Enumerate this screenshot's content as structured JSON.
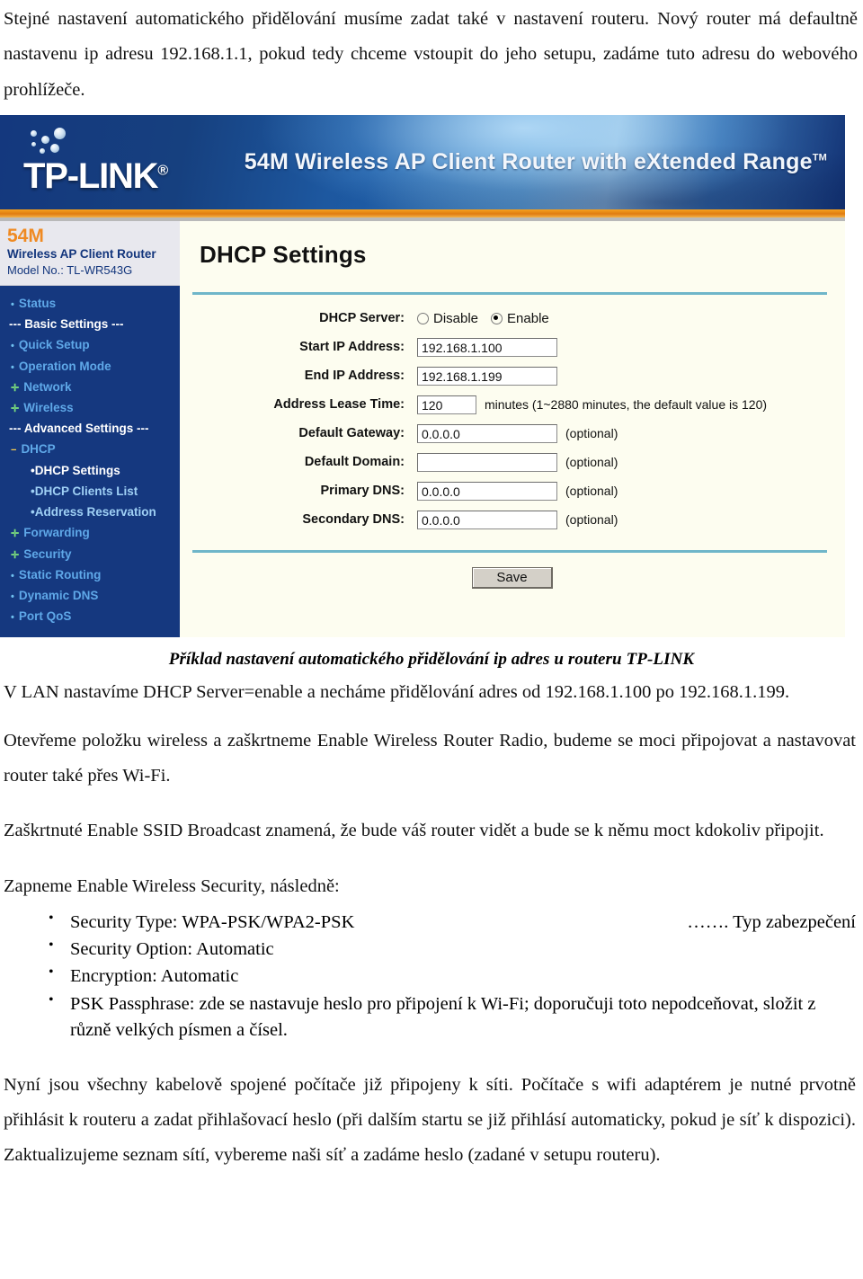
{
  "intro": {
    "paragraph": "Stejné nastavení automatického přidělování musíme zadat také v nastavení routeru. Nový router má defaultně nastavenu ip adresu 192.168.1.1, pokud tedy chceme vstoupit do jeho setupu, zadáme tuto adresu do webového prohlížeče."
  },
  "router_ui": {
    "brand": "TP-LINK",
    "brand_mark": "®",
    "tagline": "54M Wireless AP Client Router with eXtended Range",
    "tagline_mark": "TM",
    "sidebar": {
      "speed": "54M",
      "model_name": "Wireless AP Client Router",
      "model_no": "Model No.: TL-WR543G",
      "items": [
        {
          "label": "Status",
          "type": "link",
          "bullet": "dot"
        },
        {
          "label": "--- Basic Settings ---",
          "type": "section"
        },
        {
          "label": "Quick Setup",
          "type": "link",
          "bullet": "dot"
        },
        {
          "label": "Operation Mode",
          "type": "link",
          "bullet": "dot"
        },
        {
          "label": "Network",
          "type": "link",
          "bullet": "plus"
        },
        {
          "label": "Wireless",
          "type": "link",
          "bullet": "plus"
        },
        {
          "label": "--- Advanced Settings ---",
          "type": "section"
        },
        {
          "label": "DHCP",
          "type": "link",
          "bullet": "minus"
        },
        {
          "label": "DHCP Settings",
          "type": "sub",
          "active": true
        },
        {
          "label": "DHCP Clients List",
          "type": "sub",
          "active": false
        },
        {
          "label": "Address Reservation",
          "type": "sub",
          "active": false
        },
        {
          "label": "Forwarding",
          "type": "link",
          "bullet": "plus"
        },
        {
          "label": "Security",
          "type": "link",
          "bullet": "plus"
        },
        {
          "label": "Static Routing",
          "type": "link",
          "bullet": "dot"
        },
        {
          "label": "Dynamic DNS",
          "type": "link",
          "bullet": "dot"
        },
        {
          "label": "Port QoS",
          "type": "link",
          "bullet": "dot"
        }
      ]
    },
    "page_title": "DHCP Settings",
    "fields": {
      "dhcp_server_label": "DHCP Server:",
      "dhcp_disable_label": "Disable",
      "dhcp_enable_label": "Enable",
      "dhcp_selected": "Enable",
      "start_ip_label": "Start IP Address:",
      "start_ip_value": "192.168.1.100",
      "end_ip_label": "End IP Address:",
      "end_ip_value": "192.168.1.199",
      "lease_label": "Address Lease Time:",
      "lease_value": "120",
      "lease_hint": "minutes (1~2880 minutes, the default value is 120)",
      "gateway_label": "Default Gateway:",
      "gateway_value": "0.0.0.0",
      "gateway_hint": "(optional)",
      "domain_label": "Default Domain:",
      "domain_value": "",
      "domain_hint": "(optional)",
      "primary_dns_label": "Primary DNS:",
      "primary_dns_value": "0.0.0.0",
      "primary_dns_hint": "(optional)",
      "secondary_dns_label": "Secondary DNS:",
      "secondary_dns_value": "0.0.0.0",
      "secondary_dns_hint": "(optional)"
    },
    "save_label": "Save"
  },
  "caption": "Příklad nastavení automatického přidělování ip adres u routeru TP-LINK",
  "body": {
    "p1": "V LAN nastavíme DHCP Server=enable a necháme přidělování adres od 192.168.1.100 po 192.168.1.199.",
    "p2": "Otevřeme položku wireless a zaškrtneme Enable Wireless Router Radio, budeme se moci připojovat a nastavovat router také přes Wi-Fi.",
    "p3": "Zaškrtnuté Enable SSID Broadcast znamená, že bude váš router vidět a bude se k němu moct kdokoliv připojit.",
    "p4": "Zapneme Enable Wireless Security, následně:",
    "p5": "Nyní jsou všechny kabelově spojené počítače již připojeny k síti. Počítače s wifi adaptérem je nutné prvotně přihlásit k routeru a zadat přihlašovací heslo (při dalším startu se již přihlásí automaticky, pokud je síť k dispozici). Zaktualizujeme seznam sítí,  vybereme naši síť a zadáme heslo (zadané v setupu routeru)."
  },
  "bullets": [
    {
      "text": "Security Type: WPA-PSK/WPA2-PSK",
      "note": "……. Typ zabezpečení"
    },
    {
      "text": "Security Option: Automatic",
      "note": ""
    },
    {
      "text": "Encryption: Automatic",
      "note": ""
    },
    {
      "text": "PSK Passphrase: zde se nastavuje heslo pro připojení k Wi-Fi; doporučuji toto nepodceňovat,  složit z různě velkých písmen a čísel.",
      "note": ""
    }
  ]
}
